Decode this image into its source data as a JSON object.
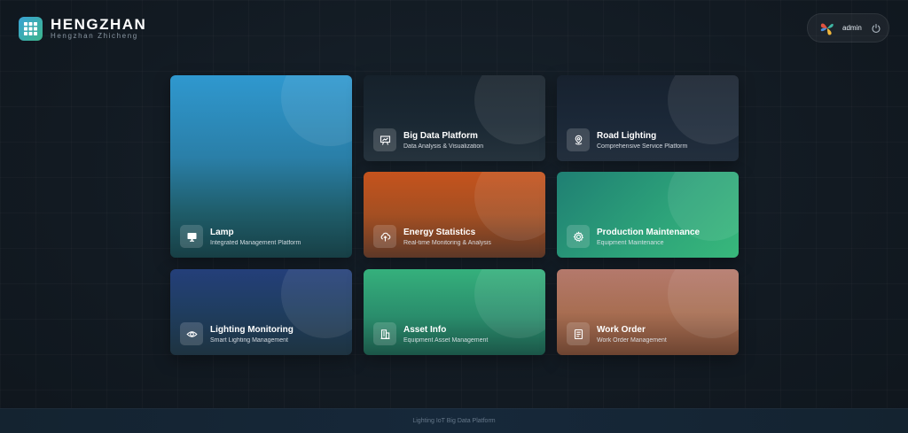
{
  "brand": {
    "title": "HENGZHAN",
    "subtitle": "Hengzhan Zhicheng",
    "logo_icon": "grid-icon",
    "accent": "#3aa3d6"
  },
  "user": {
    "name": "admin",
    "avatar_icon": "pinwheel-avatar-icon",
    "logout_icon": "power-icon"
  },
  "cards": [
    {
      "id": "lamp",
      "title": "Lamp",
      "subtitle": "Integrated Management Platform",
      "icon": "monitor-icon",
      "color": "#2f98cf"
    },
    {
      "id": "bigdata",
      "title": "Big Data Platform",
      "subtitle": "Data Analysis & Visualization",
      "icon": "presentation-chart-icon",
      "color": "#16212b"
    },
    {
      "id": "road",
      "title": "Road Lighting",
      "subtitle": "Comprehensive Service Platform",
      "icon": "location-pin-icon",
      "color": "#17212e"
    },
    {
      "id": "energy",
      "title": "Energy Statistics",
      "subtitle": "Real-time Monitoring & Analysis",
      "icon": "cloud-upload-icon",
      "color": "#c5531d"
    },
    {
      "id": "production",
      "title": "Production Maintenance",
      "subtitle": "Equipment Maintenance",
      "icon": "gear-icon",
      "color": "#2ea57a"
    },
    {
      "id": "lighting",
      "title": "Lighting Monitoring",
      "subtitle": "Smart Lighting Management",
      "icon": "eye-icon",
      "color": "#243f7a"
    },
    {
      "id": "asset",
      "title": "Asset Info",
      "subtitle": "Equipment Asset Management",
      "icon": "building-icon",
      "color": "#35b07c"
    },
    {
      "id": "workorder",
      "title": "Work Order",
      "subtitle": "Work Order Management",
      "icon": "document-icon",
      "color": "#b4796c"
    }
  ],
  "footer": {
    "text": "Lighting IoT Big Data Platform"
  }
}
